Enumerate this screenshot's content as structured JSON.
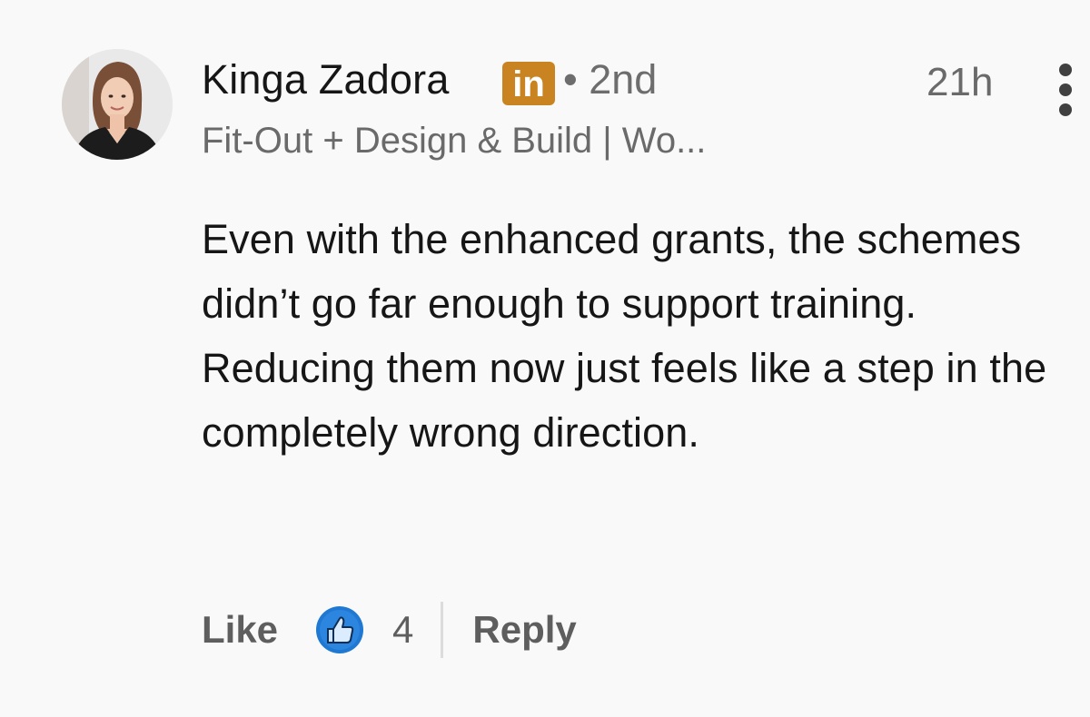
{
  "comment": {
    "author_name": "Kinga Zadora",
    "badge_text": "in",
    "degree": "• 2nd",
    "headline": "Fit-Out + Design & Build | Wo...",
    "timestamp": "21h",
    "body": "Even with the enhanced grants, the schemes didn’t go far enough to support training. Reducing them now just feels like a step in the completely wrong direction.",
    "actions": {
      "like_label": "Like",
      "reaction_icon": "thumbs-up-icon",
      "reaction_count": "4",
      "reply_label": "Reply"
    }
  },
  "colors": {
    "badge": "#c98421",
    "reaction_blue": "#1f78d1",
    "text_primary": "#161616",
    "text_secondary": "#6a6a6a"
  }
}
